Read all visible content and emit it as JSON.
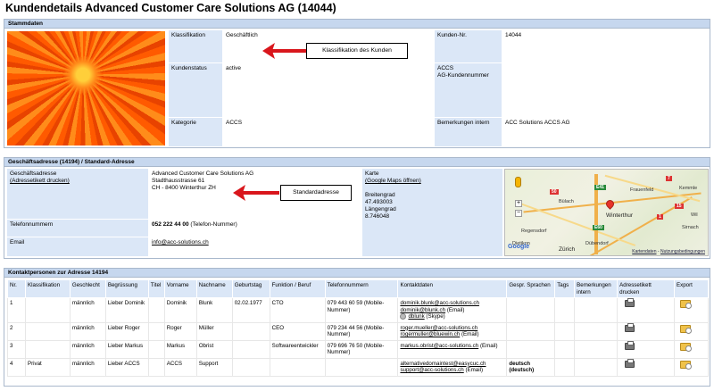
{
  "page": {
    "title": "Kundendetails Advanced Customer Care Solutions AG (14044)"
  },
  "stamm": {
    "header": "Stammdaten",
    "klassifikation_label": "Klassifikation",
    "klassifikation_value": "Geschäftlich",
    "kundenstatus_label": "Kundenstatus",
    "kundenstatus_value": "active",
    "kategorie_label": "Kategorie",
    "kategorie_value": "ACCS",
    "kundennr_label": "Kunden-Nr.",
    "kundennr_value": "14044",
    "accs_label_1": "ACCS",
    "accs_label_2": "AG-Kundennummer",
    "accs_value": "",
    "bemerkungen_label": "Bemerkungen intern",
    "bemerkungen_value": "ACC Solutions ACCS AG",
    "callout": "Klassifikation des Kunden"
  },
  "addr": {
    "header": "Geschäftsadresse (14194) / Standard-Adresse",
    "label": "Geschäftsadresse",
    "label_link": "(Adressetikett drucken)",
    "lines": [
      "Advanced Customer Care Solutions AG",
      "Stadthausstrasse 61",
      "CH - 8400 Winterthur ZH"
    ],
    "callout": "Standardadresse",
    "phone_label": "Telefonnummern",
    "phone_value": "052 222 44 00",
    "phone_type": "(Telefon-Nummer)",
    "email_label": "Email",
    "email_value": "info@acc-solutions.ch",
    "karte_label": "Karte",
    "karte_link": "(Google Maps öffnen)",
    "breitengrad_label": "Breitengrad",
    "breitengrad_value": "47.493003",
    "laengengrad_label": "Längengrad",
    "laengengrad_value": "8.746048",
    "map": {
      "places": [
        "Frauenfeld",
        "Bülach",
        "Winterthur",
        "Regensdorf",
        "Dübendorf",
        "Dietikon",
        "Zürich",
        "Wil",
        "Kemmle",
        "Sirnach"
      ],
      "badges": [
        "7",
        "E41",
        "50",
        "E60",
        "1",
        "15",
        "7"
      ],
      "google": "Google",
      "footer_data": "Kartendaten",
      "footer_terms": "Nutzungsbedingungen",
      "zoom_in": "+",
      "zoom_out": "−"
    }
  },
  "kontakt": {
    "header": "Kontaktpersonen zur Adresse 14194",
    "columns": [
      "Nr.",
      "Klassifikation",
      "Geschlecht",
      "Begrüssung",
      "Titel",
      "Vorname",
      "Nachname",
      "Geburtstag",
      "Funktion / Beruf",
      "Telefonnummern",
      "Kontaktdaten",
      "Gespr. Sprachen",
      "Tags",
      "Bemerkungen intern",
      "Adressetikett drucken",
      "Export"
    ],
    "rows": [
      {
        "nr": "1",
        "klass": "",
        "geschlecht": "männlich",
        "begruessung": "Lieber Dominik",
        "titel": "",
        "vorname": "Dominik",
        "nachname": "Blunk",
        "geburtstag": "02.02.1977",
        "funktion": "CTO",
        "telefon": "079 443 60 59 (Mobile-Nummer)",
        "kontakt1": "dominik.blunk@acc-solutions.ch",
        "kontakt1_suffix": "",
        "kontakt2": "dominik@blunk.ch",
        "kontakt2_suffix": "(Email)",
        "kontakt3": "dblunk",
        "kontakt3_suffix": "(Skype)",
        "sprachen": "",
        "sprachen2": ""
      },
      {
        "nr": "2",
        "klass": "",
        "geschlecht": "männlich",
        "begruessung": "Lieber Roger",
        "titel": "",
        "vorname": "Roger",
        "nachname": "Müller",
        "geburtstag": "",
        "funktion": "CEO",
        "telefon": "079 234 44 56 (Mobile-Nummer)",
        "kontakt1": "roger.mueller@acc-solutions.ch",
        "kontakt1_suffix": "",
        "kontakt2": "rogermuller@bluewin.ch",
        "kontakt2_suffix": "(Email)",
        "kontakt3": "",
        "kontakt3_suffix": "",
        "sprachen": "",
        "sprachen2": ""
      },
      {
        "nr": "3",
        "klass": "",
        "geschlecht": "männlich",
        "begruessung": "Lieber Markus",
        "titel": "",
        "vorname": "Markus",
        "nachname": "Obrist",
        "geburtstag": "",
        "funktion": "Softwareentwickler",
        "telefon": "079 696 76 50 (Mobile-Nummer)",
        "kontakt1": "markus.obrist@acc-solutions.ch",
        "kontakt1_suffix": "(Email)",
        "kontakt2": "",
        "kontakt2_suffix": "",
        "kontakt3": "",
        "kontakt3_suffix": "",
        "sprachen": "",
        "sprachen2": ""
      },
      {
        "nr": "4",
        "klass": "Privat",
        "geschlecht": "männlich",
        "begruessung": "Lieber ACCS",
        "titel": "",
        "vorname": "ACCS",
        "nachname": "Support",
        "geburtstag": "",
        "funktion": "",
        "telefon": "",
        "kontakt1": "alternativedomaintest@easycuc.ch",
        "kontakt1_suffix": "",
        "kontakt2": "support@acc-solutions.ch",
        "kontakt2_suffix": "(Email)",
        "kontakt3": "",
        "kontakt3_suffix": "",
        "sprachen": "deutsch",
        "sprachen2": "(deutsch)"
      }
    ]
  },
  "colors": {
    "header_bg": "#c6d7ee",
    "label_bg": "#dbe7f7",
    "border": "#a9b8cc",
    "arrow": "#d9161c"
  }
}
